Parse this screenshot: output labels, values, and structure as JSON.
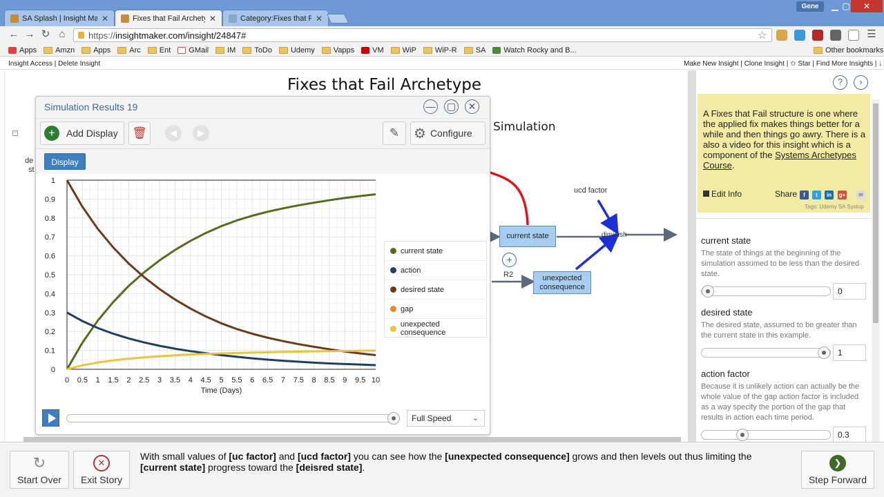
{
  "browser": {
    "tabs": [
      {
        "title": "SA Splash | Insight Maker",
        "active": false
      },
      {
        "title": "Fixes that Fail Archetype |",
        "active": true
      },
      {
        "title": "Category:Fixes that Fail - S",
        "active": false
      }
    ],
    "user": "Gene",
    "url_scheme": "https://",
    "url_host": "insightmaker.com/insight/24847#",
    "bookmarks": [
      "Apps",
      "Amzn",
      "Apps",
      "Arc",
      "Ent",
      "GMail",
      "IM",
      "ToDo",
      "Udemy",
      "Vapps",
      "VM",
      "WiP",
      "WiP-R",
      "SA",
      "Watch Rocky and B..."
    ],
    "other_bookmarks": "Other bookmarks"
  },
  "insight_bar": {
    "left": "Insight Access | Delete Insight",
    "right": "Make New Insight | Clone Insight | ✩ Star | Find More Insights | ↓"
  },
  "canvas": {
    "title": "Fixes that Fail Archetype",
    "simulation_label": "Simulation",
    "frag_left1": "de",
    "frag_left2": "st",
    "nodes": {
      "current_state": "current state",
      "unexpected_consequence": "unexpected consequence",
      "ucd_factor": "ucd factor",
      "diminish": "diminish",
      "loop": "R2",
      "plus": "+"
    }
  },
  "sim": {
    "title": "Simulation Results 19",
    "add_display": "Add Display",
    "configure": "Configure",
    "display_tab": "Display",
    "speed": "Full Speed",
    "minimize": "—",
    "restore": "▢",
    "close": "✕"
  },
  "chart_data": {
    "type": "line",
    "xlabel": "Time (Days)",
    "ylabel": "",
    "xlim": [
      0,
      10
    ],
    "ylim": [
      0,
      1
    ],
    "x_ticks": [
      "0",
      "0.5",
      "1",
      "1.5",
      "2",
      "2.5",
      "3",
      "3.5",
      "4",
      "4.5",
      "5",
      "5.5",
      "6",
      "6.5",
      "7",
      "7.5",
      "8",
      "8.5",
      "9",
      "9.5",
      "10"
    ],
    "y_ticks": [
      "0",
      "0.1",
      "0.2",
      "0.3",
      "0.4",
      "0.5",
      "0.6",
      "0.7",
      "0.8",
      "0.9",
      "1"
    ],
    "grid": true,
    "legend_position": "right",
    "x": [
      0,
      0.5,
      1,
      1.5,
      2,
      2.5,
      3,
      3.5,
      4,
      4.5,
      5,
      5.5,
      6,
      6.5,
      7,
      7.5,
      8,
      8.5,
      9,
      9.5,
      10
    ],
    "series": [
      {
        "name": "current state",
        "color": "#556b1e",
        "values": [
          0,
          0.141,
          0.258,
          0.356,
          0.441,
          0.513,
          0.576,
          0.631,
          0.679,
          0.721,
          0.757,
          0.787,
          0.812,
          0.833,
          0.851,
          0.867,
          0.881,
          0.894,
          0.906,
          0.916,
          0.925
        ]
      },
      {
        "name": "action",
        "color": "#1f3f60",
        "values": [
          0.3,
          0.255,
          0.218,
          0.188,
          0.163,
          0.142,
          0.124,
          0.109,
          0.096,
          0.085,
          0.075,
          0.066,
          0.058,
          0.051,
          0.045,
          0.04,
          0.035,
          0.031,
          0.028,
          0.025,
          0.022
        ]
      },
      {
        "name": "desired state",
        "color": "#6b3a1c",
        "values": [
          1,
          0.859,
          0.742,
          0.644,
          0.559,
          0.487,
          0.424,
          0.369,
          0.321,
          0.279,
          0.243,
          0.213,
          0.188,
          0.167,
          0.149,
          0.133,
          0.119,
          0.106,
          0.094,
          0.084,
          0.075
        ]
      },
      {
        "name": "gap",
        "color": "#e08a2a",
        "values": []
      },
      {
        "name": "unexpected consequence",
        "color": "#e8c53a",
        "values": [
          0,
          0.021,
          0.036,
          0.047,
          0.056,
          0.063,
          0.069,
          0.074,
          0.078,
          0.081,
          0.084,
          0.086,
          0.088,
          0.09,
          0.092,
          0.093,
          0.095,
          0.096,
          0.097,
          0.098,
          0.099
        ]
      }
    ]
  },
  "panel": {
    "info": "A Fixes that Fail structure is one where the applied fix makes things better for a while and then things go awry. There is a also a video for this insight which is a component of the ",
    "info_link": "Systems Archetypes Course",
    "info_end": ".",
    "edit_info": "Edit Info",
    "share": "Share",
    "tags": "Tags: Udemy SA Systop",
    "params": [
      {
        "title": "current state",
        "desc": "The state of things at the beginning of the simulation assumed to be less than the desired state.",
        "value": "0",
        "level": 0
      },
      {
        "title": "desired state",
        "desc": "The desired state, assumed to be greater than the current state in this example.",
        "value": "1",
        "level": 1
      },
      {
        "title": "action factor",
        "desc": "Because it is unlikely action can actually be the whole value of the gap action factor is included as a way specify the portion of the gap that results in action each time period.",
        "value": "0.3",
        "level": 0.3
      }
    ]
  },
  "story": {
    "start_over": "Start Over",
    "exit_story": "Exit Story",
    "step_forward": "Step Forward",
    "t1": "With small values of ",
    "b1": "[uc factor]",
    "t2": " and ",
    "b2": "[ucd factor]",
    "t3": " you can see how the ",
    "b3": "[unexpected consequence]",
    "t4": " grows and then levels out thus limiting the ",
    "b4": "[current state]",
    "t5": " progress toward the ",
    "b5": "[deisred state]",
    "t6": "."
  }
}
